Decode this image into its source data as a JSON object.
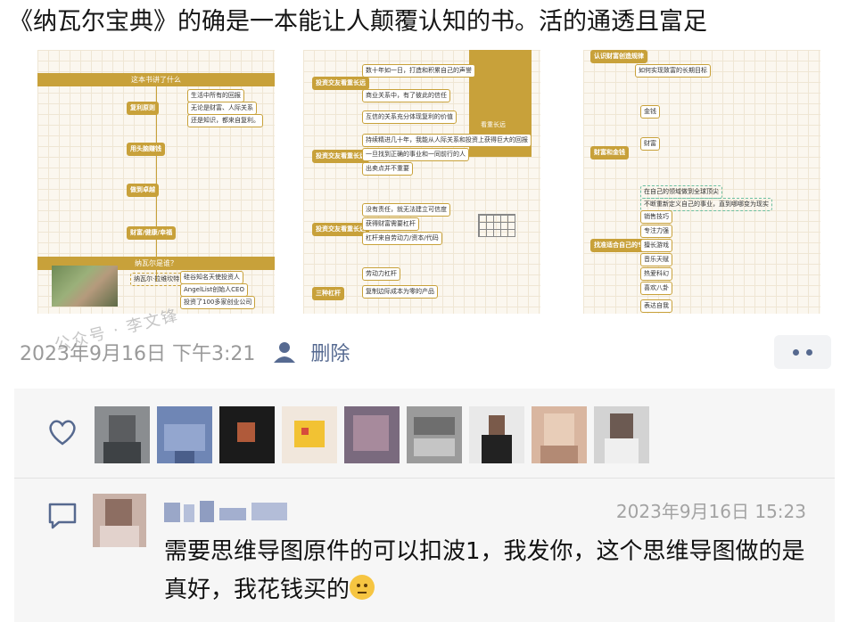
{
  "post": {
    "text": "《纳瓦尔宝典》的确是一本能让人颠覆认知的书。活的通透且富足"
  },
  "images": {
    "watermark": "公众号 · 李文锋",
    "left": {
      "title": "这本书讲了什么",
      "bottom_title": "纳瓦尔是谁？",
      "nodes": [
        "复利原则",
        "用头脑赚钱",
        "做到卓越",
        "财富/健康/幸福",
        "纳瓦尔·拉维坎特",
        "硅谷知名天使投资人",
        "AngelList创始人CEO",
        "投资了100多家创业公司",
        "生活中所有的回报",
        "无论是财富、人际关系",
        "还是知识，都来自复利。"
      ]
    },
    "middle": {
      "nodes": [
        "投资交友看重长远",
        "投资交友看重长远",
        "投资交友看重长远",
        "三种杠杆",
        "数十年如一日，打造和积累自己的声誉",
        "商业关系中，有了彼此的信任",
        "互信的关系充分体现复利的价值",
        "持续精进几十年，我能从人际关系和投资上获得巨大的回报",
        "一旦找到正确的事业和一同前行的人",
        "出卖点并不重要",
        "没有责任，就无法建立可信度",
        "获得财富需要杠杆",
        "杠杆来自劳动力/资本/代码",
        "劳动力杠杆",
        "复制边际成本为零的产品",
        "看重长远"
      ]
    },
    "right": {
      "nodes": [
        "认识财富创造规律",
        "如何实现致富的长期目标",
        "财富和金钱",
        "金钱",
        "财富",
        "在自己的领域做到全球顶尖",
        "不断重新定义自己的事业，直到哪哪变为现实",
        "找准适合自己的专长",
        "销售技巧",
        "专注力强",
        "擅长游戏",
        "音乐天赋",
        "热爱科幻",
        "喜欢八卦",
        "表达自我"
      ]
    }
  },
  "meta": {
    "time": "2023年9月16日 下午3:21",
    "delete": "删除"
  },
  "likes": {
    "count_visible": 9
  },
  "comment": {
    "time": "2023年9月16日 15:23",
    "text": "需要思维导图原件的可以扣波1，我发你，这个思维导图做的是真好，我花钱买的"
  },
  "colors": {
    "link": "#566a91",
    "gold": "#c8a13a",
    "meta_gray": "#9a9a9a"
  }
}
